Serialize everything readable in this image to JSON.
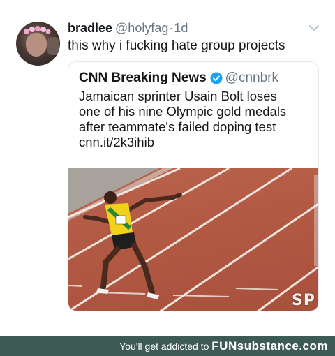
{
  "tweet": {
    "name": "bradlee",
    "handle": "@holyfag",
    "separator": "·",
    "time": "1d",
    "text": "this why i fucking hate group projects"
  },
  "quote": {
    "name": "CNN Breaking News",
    "handle": "@cnnbrk",
    "lines": [
      "Jamaican sprinter Usain Bolt loses",
      "one of his nine Olympic gold medals",
      "after teammate's failed doping test",
      "cnn.it/2k3ihib"
    ],
    "photo_watermark": "SP"
  },
  "footer": {
    "text": "You'll get addicted to",
    "brand": "FUNsubstance.com"
  },
  "colors": {
    "verified": "#1da1f2",
    "footer_bg": "#3e5a55",
    "track": "#b35a44"
  }
}
